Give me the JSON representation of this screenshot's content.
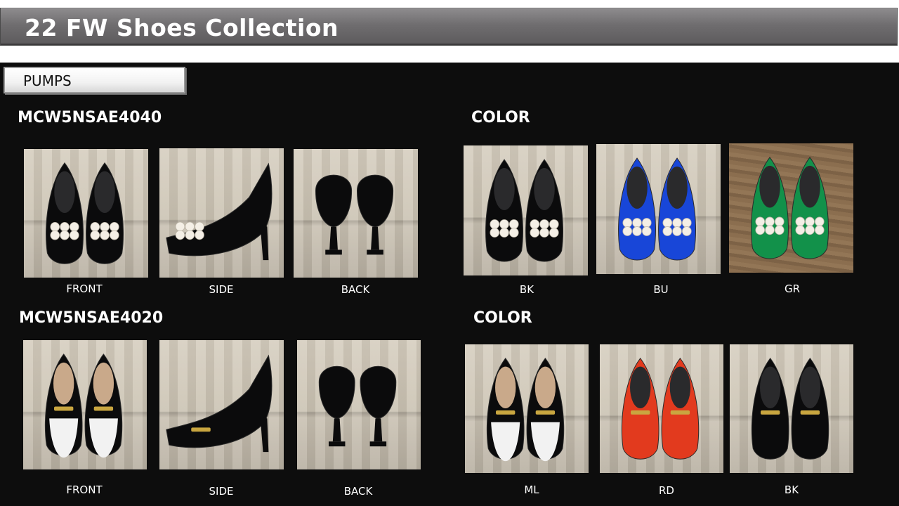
{
  "title": "22 FW Shoes Collection",
  "category": "PUMPS",
  "models": [
    {
      "code": "MCW5NSAE4040",
      "color_heading": "COLOR",
      "views": [
        "FRONT",
        "SIDE",
        "BACK"
      ],
      "colors": [
        {
          "label": "BK",
          "hex": "#0b0b0c"
        },
        {
          "label": "BU",
          "hex": "#1846d8"
        },
        {
          "label": "GR",
          "hex": "#12914a"
        }
      ],
      "main_color": "#0b0b0c",
      "ornament": "pearl-buckle"
    },
    {
      "code": "MCW5NSAE4020",
      "color_heading": "COLOR",
      "views": [
        "FRONT",
        "SIDE",
        "BACK"
      ],
      "colors": [
        {
          "label": "ML",
          "hex": "#0b0b0c",
          "toe": "#f2f2f2"
        },
        {
          "label": "RD",
          "hex": "#e23a1e"
        },
        {
          "label": "BK",
          "hex": "#0b0b0c"
        }
      ],
      "main_color": "#0b0b0c",
      "ornament": "gold-bar"
    }
  ]
}
